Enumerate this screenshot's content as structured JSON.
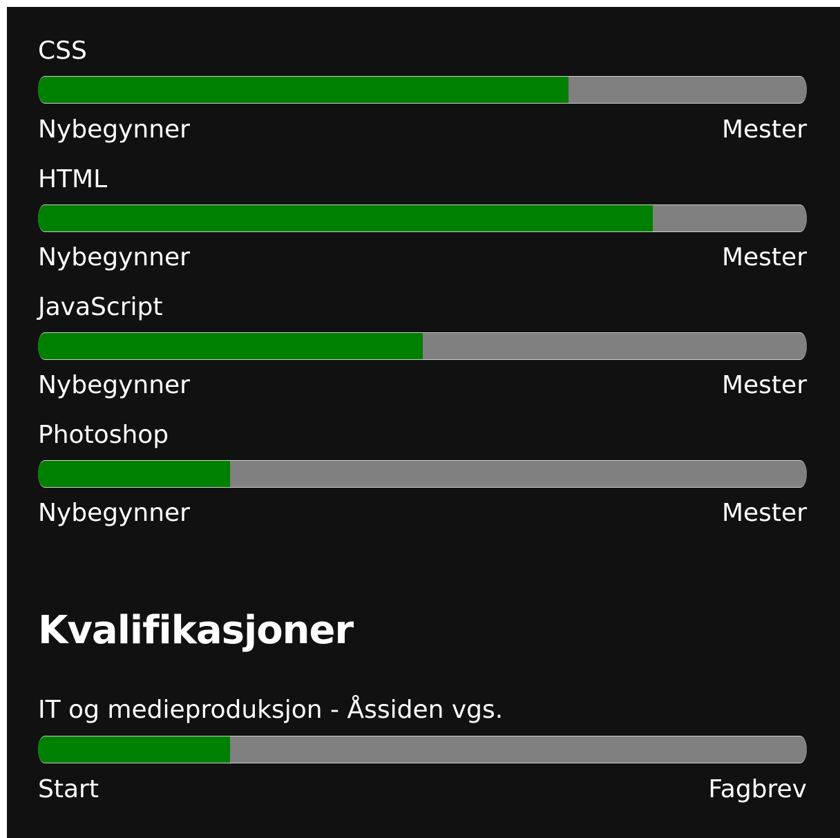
{
  "skills": [
    {
      "name": "CSS",
      "level": 0.69,
      "min_label": "Nybegynner",
      "max_label": "Mester"
    },
    {
      "name": "HTML",
      "level": 0.8,
      "min_label": "Nybegynner",
      "max_label": "Mester"
    },
    {
      "name": "JavaScript",
      "level": 0.5,
      "min_label": "Nybegynner",
      "max_label": "Mester"
    },
    {
      "name": "Photoshop",
      "level": 0.25,
      "min_label": "Nybegynner",
      "max_label": "Mester"
    }
  ],
  "qualifications": {
    "heading": "Kvalifikasjoner",
    "items": [
      {
        "name": "IT og medieproduksjon - Åssiden vgs.",
        "progress": 0.25,
        "min_label": "Start",
        "max_label": "Fagbrev"
      }
    ]
  },
  "colors": {
    "background": "#111111",
    "fill": "#008000",
    "track": "#808080",
    "text": "#ffffff"
  }
}
